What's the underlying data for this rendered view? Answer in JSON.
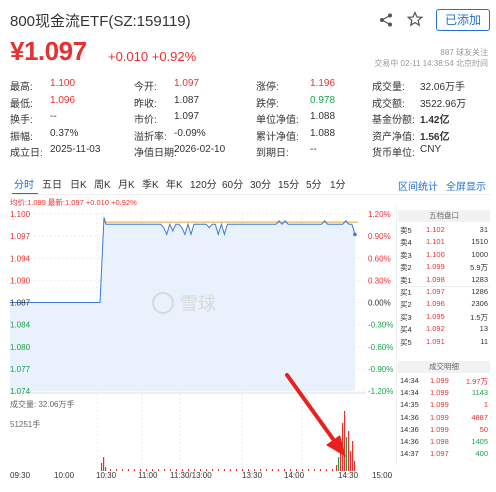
{
  "header": {
    "title": "800现金流ETF(SZ:159119)",
    "add_label": "已添加",
    "price": "¥1.097",
    "change": "+0.010  +0.92%",
    "meta_line1": "887 球友关注",
    "meta_line2": "交易中 02-11 14:38:54 北京时间"
  },
  "quote": [
    {
      "label": "最高:",
      "value": "1.100",
      "cls": "red"
    },
    {
      "label": "今开:",
      "value": "1.097",
      "cls": "red"
    },
    {
      "label": "涨停:",
      "value": "1.196",
      "cls": "red"
    },
    {
      "label": "成交量:",
      "value": "32.06万手",
      "cls": ""
    },
    {
      "label": "最低:",
      "value": "1.096",
      "cls": "red"
    },
    {
      "label": "昨收:",
      "value": "1.087",
      "cls": ""
    },
    {
      "label": "跌停:",
      "value": "0.978",
      "cls": "green"
    },
    {
      "label": "成交额:",
      "value": "3522.96万",
      "cls": ""
    },
    {
      "label": "换手:",
      "value": "--",
      "cls": ""
    },
    {
      "label": "市价:",
      "value": "1.097",
      "cls": ""
    },
    {
      "label": "单位净值:",
      "value": "1.088",
      "cls": ""
    },
    {
      "label": "基金份额:",
      "value": "1.42亿",
      "cls": ""
    },
    {
      "label": "振幅:",
      "value": "0.37%",
      "cls": ""
    },
    {
      "label": "溢折率:",
      "value": "-0.09%",
      "cls": ""
    },
    {
      "label": "累计净值:",
      "value": "1.088",
      "cls": ""
    },
    {
      "label": "资产净值:",
      "value": "1.56亿",
      "cls": ""
    },
    {
      "label": "成立日:",
      "value": "2025-11-03",
      "cls": ""
    },
    {
      "label": "净值日期:",
      "value": "2026-02-10",
      "cls": ""
    },
    {
      "label": "到期日:",
      "value": "--",
      "cls": ""
    },
    {
      "label": "货币单位:",
      "value": "CNY",
      "cls": ""
    }
  ],
  "tabs": [
    "分时",
    "五日",
    "日K",
    "周K",
    "月K",
    "季K",
    "年K",
    "120分",
    "60分",
    "30分",
    "15分",
    "5分",
    "1分"
  ],
  "tabs_right": [
    "区间统计",
    "全屏显示"
  ],
  "ohlc": "均价:1.099  最新:1.097 +0.010 +0.92%",
  "chart_data": {
    "type": "line",
    "y_left_ticks": [
      "1.100",
      "1.097",
      "1.094",
      "1.090",
      "1.087",
      "1.084",
      "1.080",
      "1.077",
      "1.074"
    ],
    "y_right_ticks": [
      "1.20%",
      "0.90%",
      "0.60%",
      "0.30%",
      "0.00%",
      "-0.30%",
      "-0.60%",
      "-0.90%",
      "-1.20%"
    ],
    "x_ticks": [
      "09:30",
      "10:00",
      "10:30",
      "11:00",
      "11:30/13:00",
      "13:30",
      "14:00",
      "14:30",
      "15:00"
    ],
    "ylim": [
      1.074,
      1.1
    ],
    "prev_close": 1.087,
    "volume_label": "成交量: 32.06万手",
    "volume_max_label": "51251手",
    "watermark": "雪球"
  },
  "orderbook": {
    "title": "五档盘口",
    "rows": [
      {
        "n": "卖5",
        "p": "1.102",
        "q": "31",
        "cls": "red"
      },
      {
        "n": "卖4",
        "p": "1.101",
        "q": "1510",
        "cls": "red"
      },
      {
        "n": "卖3",
        "p": "1.100",
        "q": "1000",
        "cls": "red"
      },
      {
        "n": "卖2",
        "p": "1.099",
        "q": "5.9万",
        "cls": "red"
      },
      {
        "n": "卖1",
        "p": "1.098",
        "q": "1283",
        "cls": "red"
      },
      {
        "n": "买1",
        "p": "1.097",
        "q": "1286",
        "cls": "red"
      },
      {
        "n": "买2",
        "p": "1.096",
        "q": "2306",
        "cls": "red"
      },
      {
        "n": "买3",
        "p": "1.095",
        "q": "1.5万",
        "cls": "red"
      },
      {
        "n": "买4",
        "p": "1.092",
        "q": "13",
        "cls": "red"
      },
      {
        "n": "买5",
        "p": "1.091",
        "q": "11",
        "cls": "red"
      }
    ]
  },
  "trades": {
    "title": "成交明细",
    "rows": [
      {
        "t": "14:34",
        "p": "1.099",
        "q": "1.97万",
        "cls": "red",
        "qcls": "red"
      },
      {
        "t": "14:34",
        "p": "1.099",
        "q": "1143",
        "cls": "red",
        "qcls": "green"
      },
      {
        "t": "14:35",
        "p": "1.099",
        "q": "1",
        "cls": "red",
        "qcls": "red"
      },
      {
        "t": "14:36",
        "p": "1.099",
        "q": "4887",
        "cls": "red",
        "qcls": "red"
      },
      {
        "t": "14:36",
        "p": "1.099",
        "q": "50",
        "cls": "red",
        "qcls": "red"
      },
      {
        "t": "14:36",
        "p": "1.098",
        "q": "1405",
        "cls": "red",
        "qcls": "green"
      },
      {
        "t": "14:37",
        "p": "1.097",
        "q": "400",
        "cls": "red",
        "qcls": "green"
      }
    ]
  },
  "colors": {
    "up": "#e93030",
    "down": "#1aa34a",
    "accent": "#1f6fd6"
  }
}
